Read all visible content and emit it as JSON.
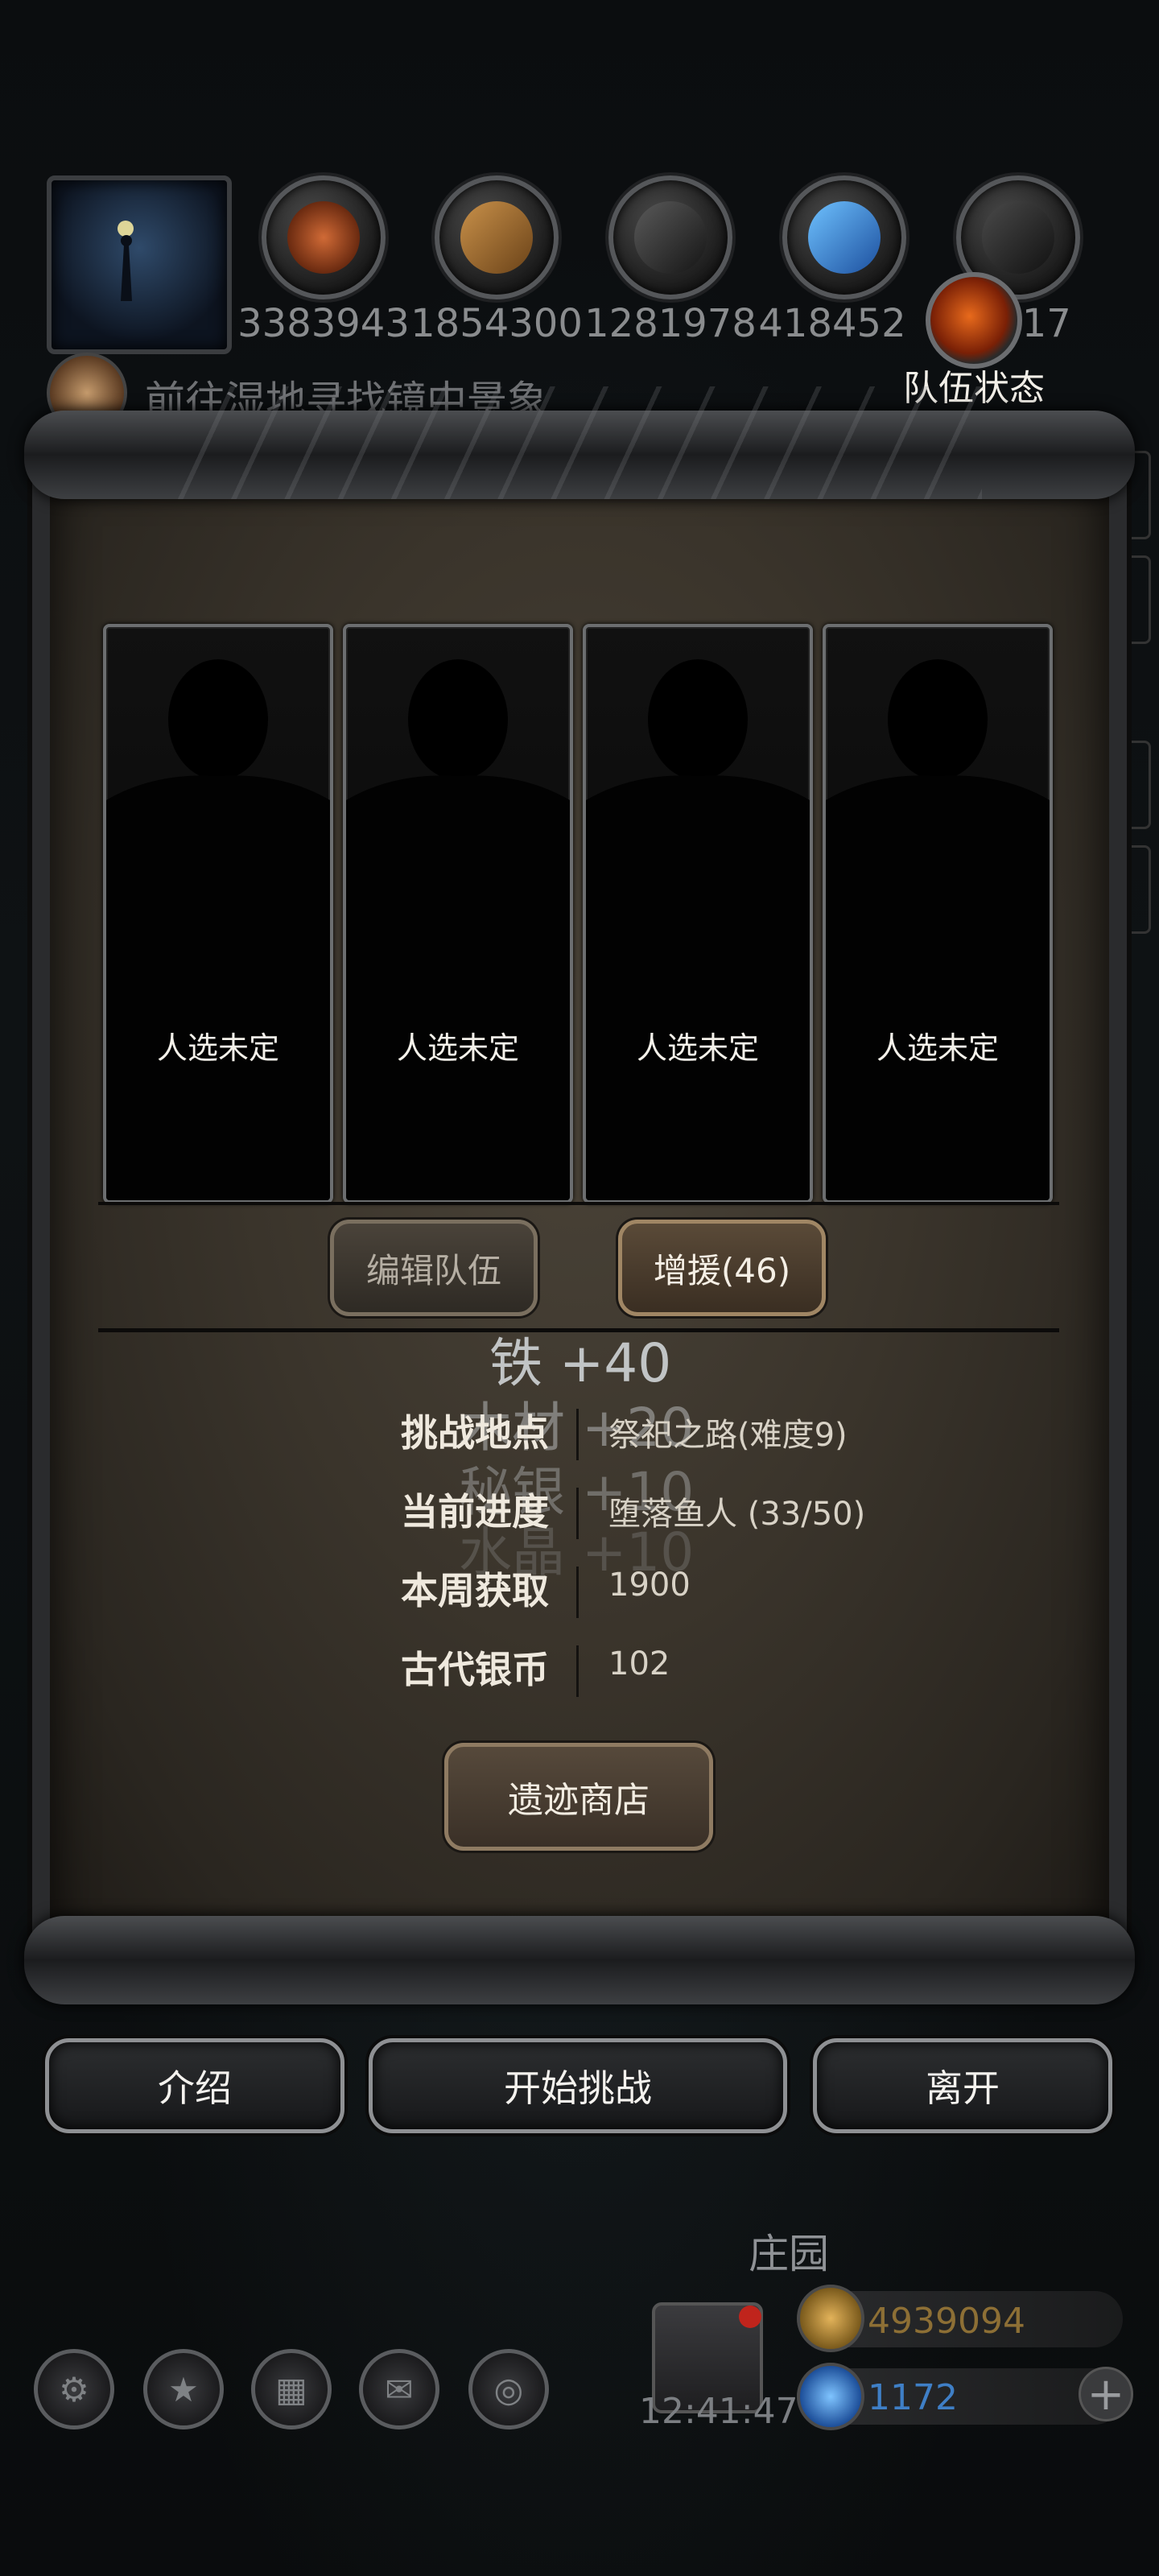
{
  "resources": [
    {
      "icon": "meat-icon",
      "value": "3383943",
      "color": "#b5542a"
    },
    {
      "icon": "wood-planks-icon",
      "value": "1854300",
      "color": "#a06a2c"
    },
    {
      "icon": "iron-ingot-icon",
      "value": "1281978",
      "color": "#2b2b2b"
    },
    {
      "icon": "crystal-icon",
      "value": "418452",
      "color": "#2e7fd6"
    },
    {
      "icon": "stone-icon",
      "value": "017",
      "color": "#2a2a2a"
    }
  ],
  "team_status": {
    "label": "队伍状态",
    "icon": "flame-icon"
  },
  "quest": {
    "text": "前往湿地寻找镜中景象",
    "icon": "scroll-icon"
  },
  "members": [
    {
      "label": "人选未定"
    },
    {
      "label": "人选未定"
    },
    {
      "label": "人选未定"
    },
    {
      "label": "人选未定"
    }
  ],
  "buttons": {
    "edit_team": "编辑队伍",
    "reinforce": "增援(46)",
    "shop": "遗迹商店",
    "intro": "介绍",
    "start": "开始挑战",
    "leave": "离开"
  },
  "loot_floats": [
    "铁 +40",
    "木材 +20",
    "秘银 +10",
    "水晶 +10"
  ],
  "info": [
    {
      "label": "挑战地点",
      "value": "祭祀之路(难度9)"
    },
    {
      "label": "当前进度",
      "value": "堕落鱼人 (33/50)"
    },
    {
      "label": "本周获取",
      "value": "1900"
    },
    {
      "label": "古代银币",
      "value": "102"
    }
  ],
  "hud": {
    "manor": "庄园",
    "clock": "12:41:47",
    "gold": "4939094",
    "gems": "1172",
    "plus": "+"
  }
}
